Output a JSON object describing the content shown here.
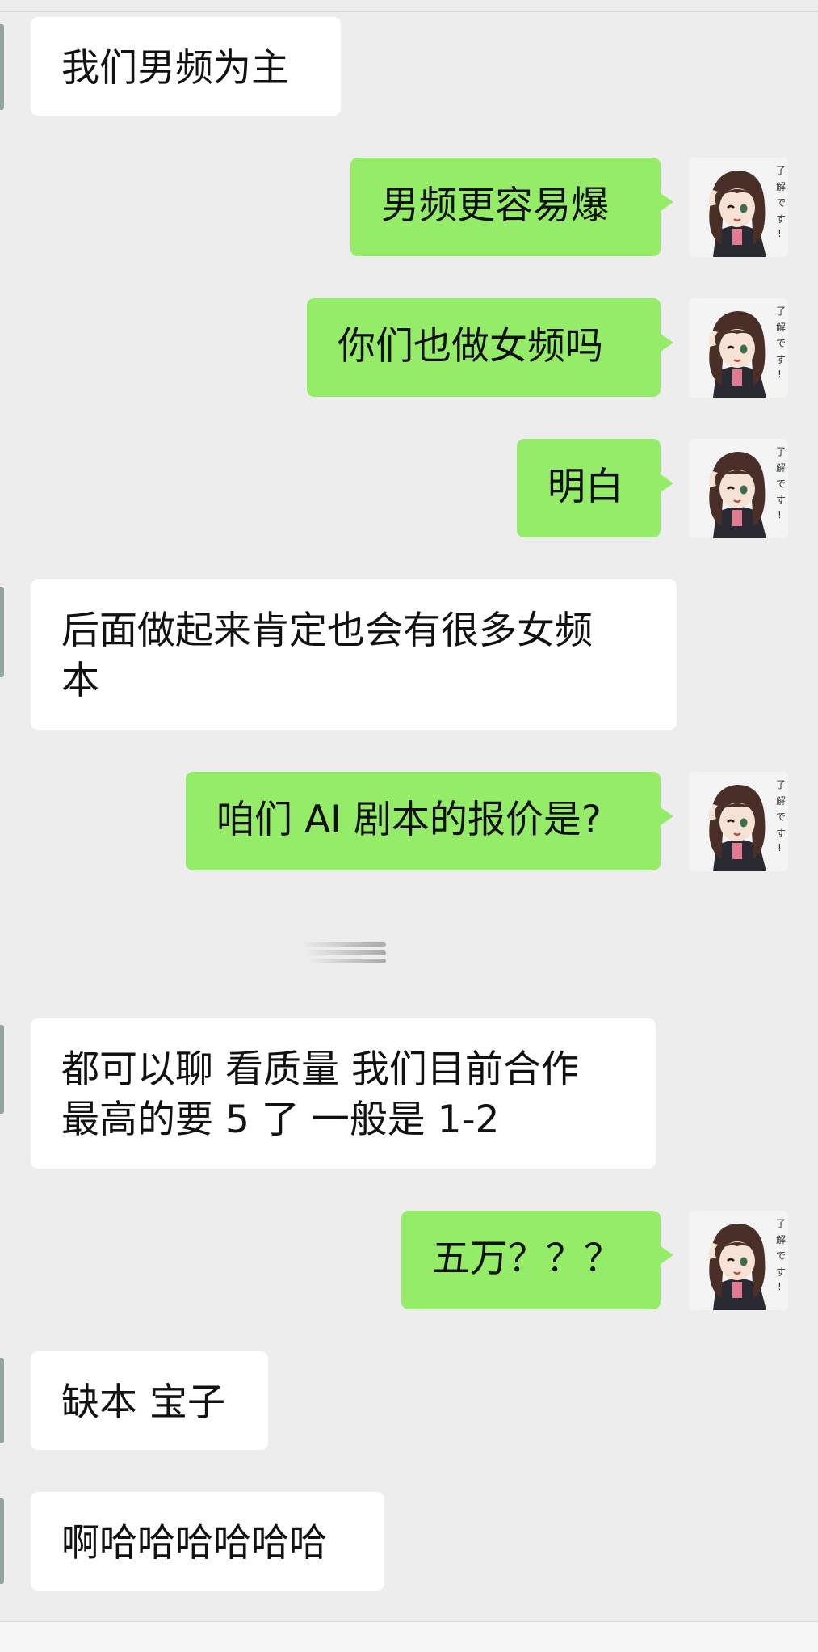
{
  "messages": [
    {
      "direction": "in",
      "text": "我们男频为主"
    },
    {
      "direction": "out",
      "text": "男频更容易爆"
    },
    {
      "direction": "out",
      "text": "你们也做女频吗"
    },
    {
      "direction": "out",
      "text": "明白"
    },
    {
      "direction": "in",
      "text": "后面做起来肯定也会有很多女频\n本"
    },
    {
      "direction": "out",
      "text": "咱们 AI 剧本的报价是?"
    },
    {
      "direction": "in",
      "text": "都可以聊 看质量 我们目前合作\n最高的要 5 了 一般是 1-2"
    },
    {
      "direction": "out",
      "text": "五万？？？"
    },
    {
      "direction": "in",
      "text": "缺本 宝子"
    },
    {
      "direction": "in",
      "text": "啊哈哈哈哈哈哈"
    }
  ],
  "self_avatar": {
    "icon": "anime-girl-sticker-avatar",
    "caption": "了解です!"
  },
  "colors": {
    "background": "#ededed",
    "incoming_bubble": "#ffffff",
    "outgoing_bubble": "#95ec69",
    "text": "#111111"
  }
}
